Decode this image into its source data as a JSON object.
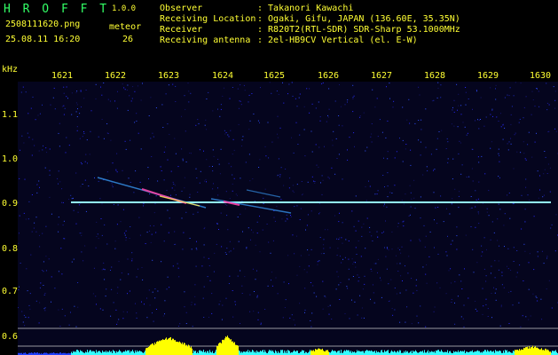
{
  "header": {
    "logo": "H R O F F T",
    "version": "1.0.0",
    "filename": "2508111620.png",
    "timestamp": "25.08.11 16:20",
    "mode_label": "meteor",
    "count": "26"
  },
  "info": {
    "observer_label": "Observer",
    "observer_value": ": Takanori Kawachi",
    "location_label": "Receiving Location",
    "location_value": ": Ogaki, Gifu, JAPAN (136.60E, 35.35N)",
    "receiver_label": "Receiver",
    "receiver_value": ": R820T2(RTL-SDR) SDR-Sharp 53.1000MHz",
    "antenna_label": "Receiving antenna",
    "antenna_value": ": 2el-HB9CV Vertical (el. E-W)"
  },
  "axes": {
    "y_unit": "kHz",
    "x_ticks": [
      "1621",
      "1622",
      "1623",
      "1624",
      "1625",
      "1626",
      "1627",
      "1628",
      "1629",
      "1630"
    ],
    "y_ticks": [
      "1.1",
      "1.0",
      "0.9",
      "0.8",
      "0.7",
      "0.6"
    ]
  },
  "colors": {
    "background": "#05051e",
    "carrier": "#80ffff",
    "meteor": "#ff44aa",
    "text_yellow": "#ffff33",
    "text_green": "#33ff66",
    "text_cyan": "#33ffff",
    "bars_cyan": "#33ffff",
    "bars_yellow": "#ffff00"
  }
}
